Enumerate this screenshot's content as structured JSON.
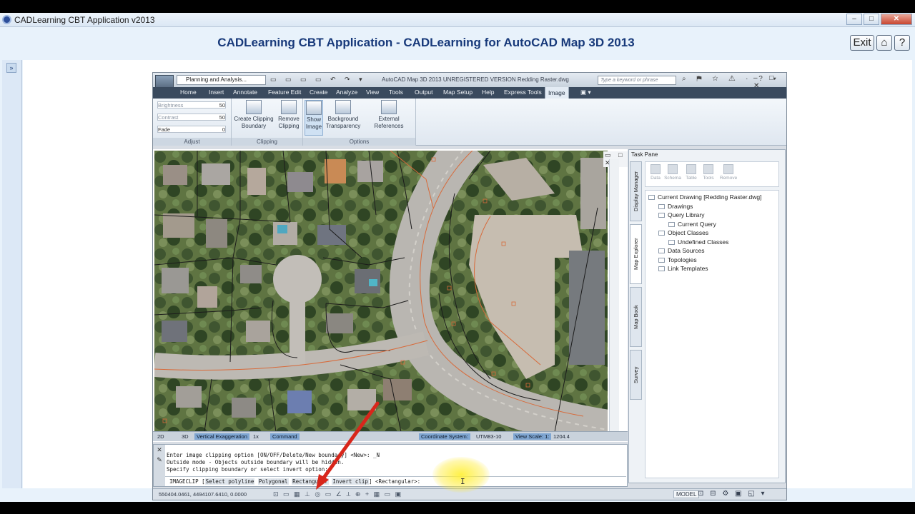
{
  "window": {
    "title": "CADLearning CBT Application v2013",
    "min_label": "–",
    "max_label": "□",
    "close_label": "✕"
  },
  "header": {
    "title": "CADLearning CBT Application - CADLearning for AutoCAD Map 3D 2013",
    "exit_label": "Exit",
    "home_label": "⌂",
    "help_label": "?",
    "side_toggle": "»"
  },
  "acad": {
    "app_button": "MAP",
    "workspace": "Planning and Analysis...",
    "qat": "▭ ▭ ▭ ▭ ↶ ↷ ▾",
    "title": "AutoCAD Map 3D 2013   UNREGISTERED VERSION   Redding Raster.dwg",
    "search_placeholder": "Type a keyword or phrase",
    "title_icons": "⌕ ⚑ ☆ ⚠ · ? ▾",
    "win_buttons": "– □ ✕",
    "tabs": [
      "Home",
      "Insert",
      "Annotate",
      "Feature Edit",
      "Create",
      "Analyze",
      "View",
      "Tools",
      "Output",
      "Map Setup",
      "Help",
      "Express Tools",
      "Image",
      "▣ ▾"
    ],
    "active_tab": "Image",
    "adjust": {
      "title": "Adjust",
      "rows": [
        {
          "label": "Brightness",
          "value": "50"
        },
        {
          "label": "Contrast",
          "value": "50"
        },
        {
          "label": "Fade",
          "value": "0"
        }
      ]
    },
    "clipping": {
      "title": "Clipping",
      "create_label_1": "Create Clipping",
      "create_label_2": "Boundary",
      "remove_label_1": "Remove",
      "remove_label_2": "Clipping"
    },
    "options": {
      "title": "Options",
      "show_label_1": "Show",
      "show_label_2": "Image",
      "bg_label_1": "Background",
      "bg_label_2": "Transparency",
      "ext_label": "External References"
    }
  },
  "taskpane": {
    "title": "Task Pane",
    "tools": [
      "Data",
      "Schema",
      "Table",
      "Tools",
      "Remove"
    ],
    "tree": [
      {
        "label": "Current Drawing [Redding Raster.dwg]",
        "level": 0
      },
      {
        "label": "Drawings",
        "level": 1
      },
      {
        "label": "Query Library",
        "level": 1
      },
      {
        "label": "Current Query",
        "level": 2
      },
      {
        "label": "Object Classes",
        "level": 1
      },
      {
        "label": "Undefined Classes",
        "level": 2
      },
      {
        "label": "Data Sources",
        "level": 1
      },
      {
        "label": "Topologies",
        "level": 1
      },
      {
        "label": "Link Templates",
        "level": 1
      }
    ],
    "vtabs": [
      "Display Manager",
      "Map Explorer",
      "Map Book",
      "Survey"
    ],
    "active_vtab": "Map Explorer"
  },
  "map_status": {
    "coord_2d": "2D",
    "coord_3d": "3D",
    "vert_exag": "Vertical Exaggeration",
    "vert_val": "1x",
    "command": "Command",
    "coord_sys": "Coordinate System:",
    "utm": "UTM83-10",
    "view_scale": "View Scale: 1:",
    "scale_val": "1204.4"
  },
  "command": {
    "line1": "Enter image clipping option [ON/OFF/Delete/New boundary] <New>: _N",
    "line2": "Outside mode - Objects outside boundary will be hidden.",
    "line3": "Specify clipping boundary or select invert option:",
    "prompt": "IMAGECLIP",
    "opt1": "Select polyline",
    "opt2": "Polygonal",
    "opt3": "Rectangular",
    "opt4": "Invert clip",
    "default": "<Rectangular>:",
    "side_icons": "✕ ✎"
  },
  "status": {
    "coords": "550404.0461, 4494107.6410, 0.0000",
    "icons": "⊡ ▭ ▦ ⊥ ◎ ▭ ∠ ⟂ ⊕ + ▦ ▭ ▣",
    "model": "MODEL",
    "right_icons": "⊡ ⊟ ⚙ ▣ ◱ ▾"
  }
}
